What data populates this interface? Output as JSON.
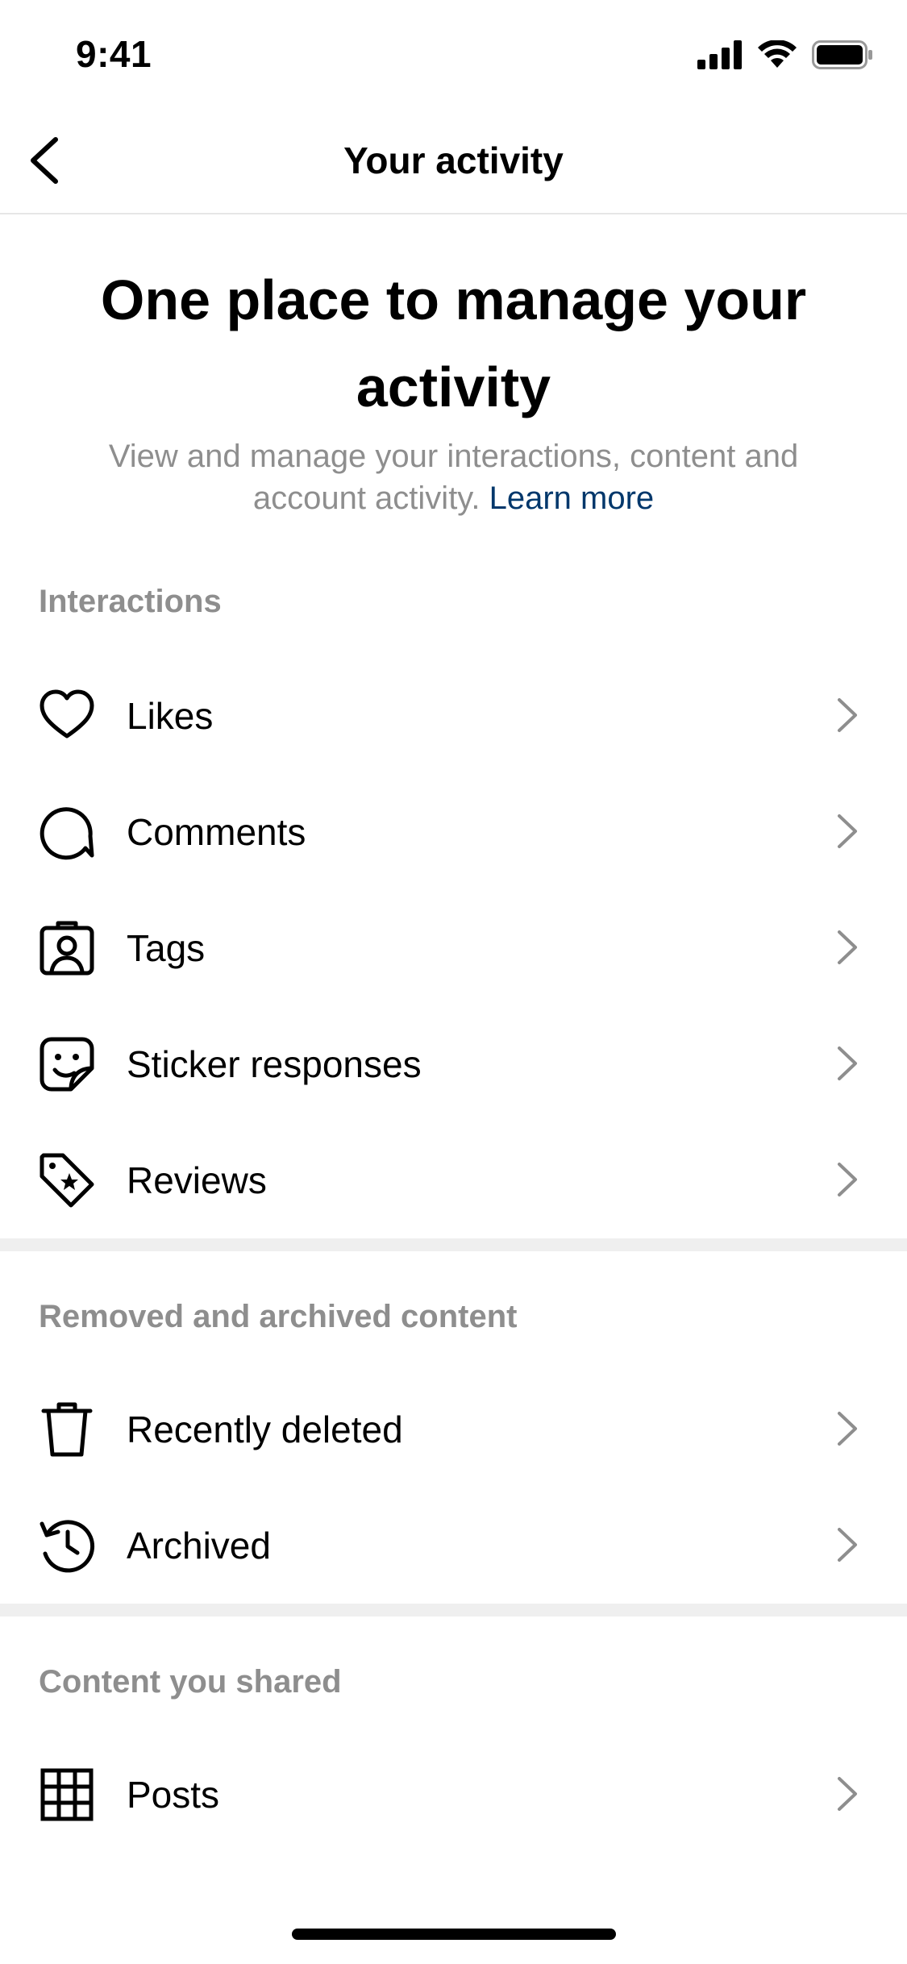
{
  "status_bar": {
    "time": "9:41"
  },
  "header": {
    "title": "Your activity",
    "back_icon": "chevron-left-icon"
  },
  "hero": {
    "title": "One place to manage your activity",
    "subtitle": "View and manage your interactions, content and account activity.",
    "link": "Learn more"
  },
  "sections": {
    "interactions": {
      "title": "Interactions",
      "items": [
        {
          "label": "Likes",
          "icon": "heart-icon"
        },
        {
          "label": "Comments",
          "icon": "comment-bubble-icon"
        },
        {
          "label": "Tags",
          "icon": "tag-person-icon"
        },
        {
          "label": "Sticker responses",
          "icon": "sticker-icon"
        },
        {
          "label": "Reviews",
          "icon": "review-tag-icon"
        }
      ]
    },
    "removed": {
      "title": "Removed and archived content",
      "items": [
        {
          "label": "Recently deleted",
          "icon": "trash-icon"
        },
        {
          "label": "Archived",
          "icon": "archive-clock-icon"
        }
      ]
    },
    "shared": {
      "title": "Content you shared",
      "items": [
        {
          "label": "Posts",
          "icon": "grid-icon"
        }
      ]
    }
  },
  "colors": {
    "text": "#000000",
    "secondary": "#8e8e8e",
    "link": "#00376b",
    "divider": "#efefef"
  }
}
